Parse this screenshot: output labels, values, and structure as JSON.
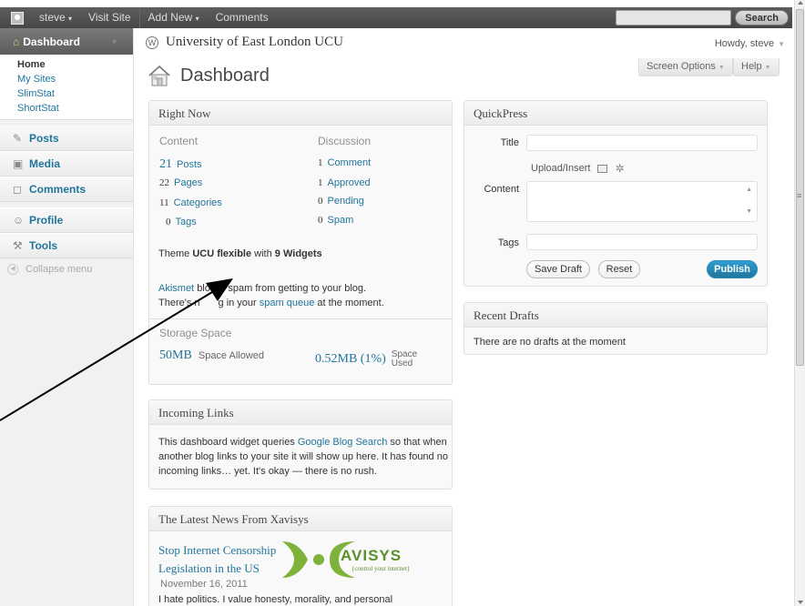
{
  "adminbar": {
    "user": "steve",
    "user_caret": "▾",
    "visit_site": "Visit Site",
    "add_new": "Add New",
    "add_new_caret": "▾",
    "comments": "Comments",
    "search_button": "Search"
  },
  "sidebar": {
    "dashboard": "Dashboard",
    "submenu": [
      "Home",
      "My Sites",
      "SlimStat",
      "ShortStat"
    ],
    "items": [
      {
        "label": "Posts",
        "icon": "pin-icon"
      },
      {
        "label": "Media",
        "icon": "media-icon"
      },
      {
        "label": "Comments",
        "icon": "comments-icon"
      },
      {
        "label": "Profile",
        "icon": "profile-icon"
      },
      {
        "label": "Tools",
        "icon": "tools-icon"
      }
    ],
    "collapse": "Collapse menu"
  },
  "header": {
    "site_title": "University of East London UCU",
    "howdy": "Howdy, steve",
    "screen_options": "Screen Options",
    "help": "Help",
    "page_title": "Dashboard"
  },
  "right_now": {
    "title": "Right Now",
    "content_head": "Content",
    "discussion_head": "Discussion",
    "content": [
      {
        "n": "21",
        "label": "Posts"
      },
      {
        "n": "22",
        "label": "Pages"
      },
      {
        "n": "11",
        "label": "Categories"
      },
      {
        "n": "0",
        "label": "Tags"
      }
    ],
    "discussion": [
      {
        "n": "1",
        "label": "Comment"
      },
      {
        "n": "1",
        "label": "Approved"
      },
      {
        "n": "0",
        "label": "Pending"
      },
      {
        "n": "0",
        "label": "Spam"
      }
    ],
    "theme_prefix": "Theme",
    "theme_name": "UCU flexible",
    "theme_with": "with",
    "theme_widgets": "9 Widgets",
    "akismet": "Akismet",
    "akismet_text": "blocks spam from getting to your blog.",
    "nothing_prefix": "There's n",
    "nothing_mid": "g in your",
    "spam_queue": "spam queue",
    "nothing_suffix": "at the moment.",
    "storage_head": "Storage Space",
    "space_allowed_value": "50MB",
    "space_allowed_label": "Space Allowed",
    "space_used_value": "0.52MB (1%)",
    "space_used_label_1": "Space",
    "space_used_label_2": "Used"
  },
  "quickpress": {
    "title": "QuickPress",
    "title_label": "Title",
    "upload_insert": "Upload/Insert",
    "content_label": "Content",
    "tags_label": "Tags",
    "save_draft": "Save Draft",
    "reset": "Reset",
    "publish": "Publish"
  },
  "recent_drafts": {
    "title": "Recent Drafts",
    "text": "There are no drafts at the moment"
  },
  "incoming_links": {
    "title": "Incoming Links",
    "text_1": "This dashboard widget queries",
    "link": "Google Blog Search",
    "text_2": "so that when",
    "line_2": "another blog links to your site it will show up here. It has found no",
    "line_3": "incoming links… yet. It's okay — there is no rush."
  },
  "news": {
    "title": "The Latest News From Xavisys",
    "item_title_1": "Stop Internet Censorship",
    "item_title_2": "Legislation in the US",
    "date": "November 16, 2011",
    "excerpt": "I hate politics. I value honesty, morality, and personal",
    "logo_text": "AVISYS",
    "logo_tag": "{control your internet}"
  },
  "colors": {
    "link": "#21759b",
    "adminbar": "#464646",
    "publish": "#21759b",
    "logo_green": "#7fb23a"
  }
}
